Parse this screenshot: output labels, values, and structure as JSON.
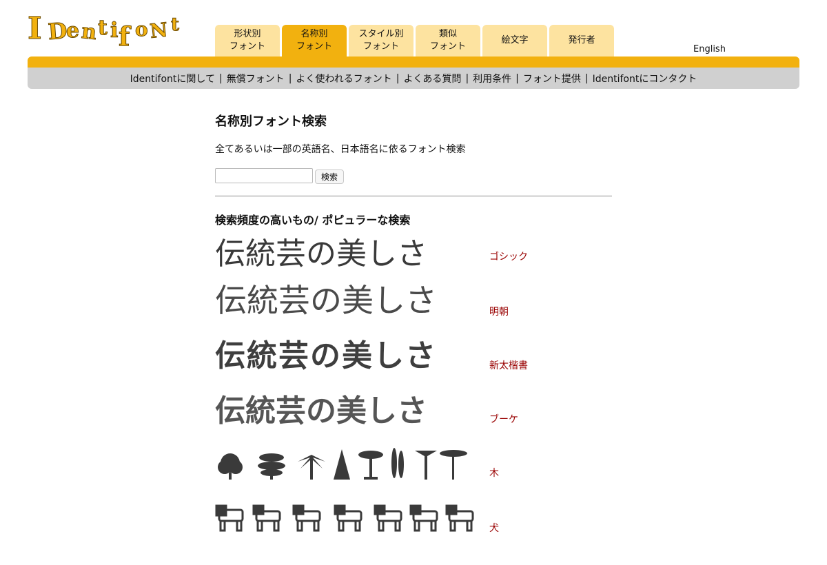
{
  "header": {
    "logo_text": "IDentifont",
    "tabs": [
      {
        "line1": "形状別",
        "line2": "フォント",
        "active": false
      },
      {
        "line1": "名称別",
        "line2": "フォント",
        "active": true
      },
      {
        "line1": "スタイル別",
        "line2": "フォント",
        "active": false
      },
      {
        "line1": "類似",
        "line2": "フォント",
        "active": false
      },
      {
        "line1": "絵文字",
        "line2": "",
        "active": false
      },
      {
        "line1": "発行者",
        "line2": "",
        "active": false
      }
    ],
    "language_link": "English"
  },
  "nav": {
    "links": [
      "Identifontに関して",
      "無償フォント",
      "よく使われるフォント",
      "よくある質問",
      "利用条件",
      "フォント提供",
      "Identifontにコンタクト"
    ],
    "separator": "|"
  },
  "main": {
    "title": "名称別フォント検索",
    "description": "全てあるいは一部の英語名、日本語名に依るフォント検索",
    "search_value": "",
    "search_button": "検索",
    "popular_heading": "検索頻度の高いもの/ ポピュラーな検索",
    "sample_text": "伝統芸の美しさ",
    "popular": [
      {
        "label": "ゴシック"
      },
      {
        "label": "明朝"
      },
      {
        "label": "新太楷書"
      },
      {
        "label": "ブーケ"
      },
      {
        "label": "木"
      },
      {
        "label": "犬"
      }
    ]
  },
  "colors": {
    "accent": "#f2b10f",
    "tab": "#fde3a0",
    "nav_bar": "#d0d0d0",
    "link": "#990000"
  }
}
